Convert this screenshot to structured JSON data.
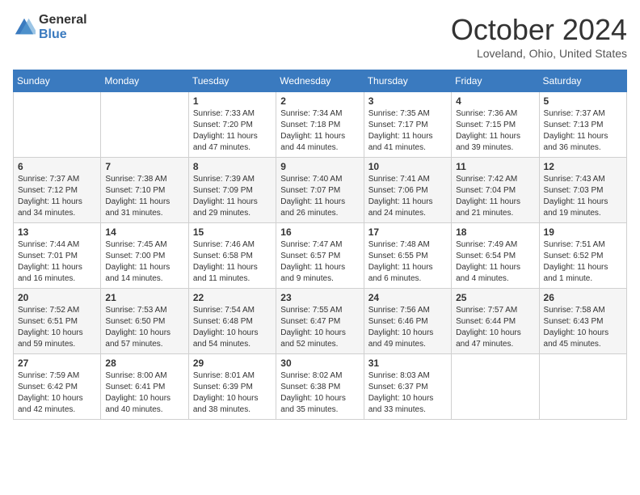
{
  "header": {
    "logo_general": "General",
    "logo_blue": "Blue",
    "month": "October 2024",
    "location": "Loveland, Ohio, United States"
  },
  "days_of_week": [
    "Sunday",
    "Monday",
    "Tuesday",
    "Wednesday",
    "Thursday",
    "Friday",
    "Saturday"
  ],
  "weeks": [
    [
      {
        "day": "",
        "info": ""
      },
      {
        "day": "",
        "info": ""
      },
      {
        "day": "1",
        "info": "Sunrise: 7:33 AM\nSunset: 7:20 PM\nDaylight: 11 hours and 47 minutes."
      },
      {
        "day": "2",
        "info": "Sunrise: 7:34 AM\nSunset: 7:18 PM\nDaylight: 11 hours and 44 minutes."
      },
      {
        "day": "3",
        "info": "Sunrise: 7:35 AM\nSunset: 7:17 PM\nDaylight: 11 hours and 41 minutes."
      },
      {
        "day": "4",
        "info": "Sunrise: 7:36 AM\nSunset: 7:15 PM\nDaylight: 11 hours and 39 minutes."
      },
      {
        "day": "5",
        "info": "Sunrise: 7:37 AM\nSunset: 7:13 PM\nDaylight: 11 hours and 36 minutes."
      }
    ],
    [
      {
        "day": "6",
        "info": "Sunrise: 7:37 AM\nSunset: 7:12 PM\nDaylight: 11 hours and 34 minutes."
      },
      {
        "day": "7",
        "info": "Sunrise: 7:38 AM\nSunset: 7:10 PM\nDaylight: 11 hours and 31 minutes."
      },
      {
        "day": "8",
        "info": "Sunrise: 7:39 AM\nSunset: 7:09 PM\nDaylight: 11 hours and 29 minutes."
      },
      {
        "day": "9",
        "info": "Sunrise: 7:40 AM\nSunset: 7:07 PM\nDaylight: 11 hours and 26 minutes."
      },
      {
        "day": "10",
        "info": "Sunrise: 7:41 AM\nSunset: 7:06 PM\nDaylight: 11 hours and 24 minutes."
      },
      {
        "day": "11",
        "info": "Sunrise: 7:42 AM\nSunset: 7:04 PM\nDaylight: 11 hours and 21 minutes."
      },
      {
        "day": "12",
        "info": "Sunrise: 7:43 AM\nSunset: 7:03 PM\nDaylight: 11 hours and 19 minutes."
      }
    ],
    [
      {
        "day": "13",
        "info": "Sunrise: 7:44 AM\nSunset: 7:01 PM\nDaylight: 11 hours and 16 minutes."
      },
      {
        "day": "14",
        "info": "Sunrise: 7:45 AM\nSunset: 7:00 PM\nDaylight: 11 hours and 14 minutes."
      },
      {
        "day": "15",
        "info": "Sunrise: 7:46 AM\nSunset: 6:58 PM\nDaylight: 11 hours and 11 minutes."
      },
      {
        "day": "16",
        "info": "Sunrise: 7:47 AM\nSunset: 6:57 PM\nDaylight: 11 hours and 9 minutes."
      },
      {
        "day": "17",
        "info": "Sunrise: 7:48 AM\nSunset: 6:55 PM\nDaylight: 11 hours and 6 minutes."
      },
      {
        "day": "18",
        "info": "Sunrise: 7:49 AM\nSunset: 6:54 PM\nDaylight: 11 hours and 4 minutes."
      },
      {
        "day": "19",
        "info": "Sunrise: 7:51 AM\nSunset: 6:52 PM\nDaylight: 11 hours and 1 minute."
      }
    ],
    [
      {
        "day": "20",
        "info": "Sunrise: 7:52 AM\nSunset: 6:51 PM\nDaylight: 10 hours and 59 minutes."
      },
      {
        "day": "21",
        "info": "Sunrise: 7:53 AM\nSunset: 6:50 PM\nDaylight: 10 hours and 57 minutes."
      },
      {
        "day": "22",
        "info": "Sunrise: 7:54 AM\nSunset: 6:48 PM\nDaylight: 10 hours and 54 minutes."
      },
      {
        "day": "23",
        "info": "Sunrise: 7:55 AM\nSunset: 6:47 PM\nDaylight: 10 hours and 52 minutes."
      },
      {
        "day": "24",
        "info": "Sunrise: 7:56 AM\nSunset: 6:46 PM\nDaylight: 10 hours and 49 minutes."
      },
      {
        "day": "25",
        "info": "Sunrise: 7:57 AM\nSunset: 6:44 PM\nDaylight: 10 hours and 47 minutes."
      },
      {
        "day": "26",
        "info": "Sunrise: 7:58 AM\nSunset: 6:43 PM\nDaylight: 10 hours and 45 minutes."
      }
    ],
    [
      {
        "day": "27",
        "info": "Sunrise: 7:59 AM\nSunset: 6:42 PM\nDaylight: 10 hours and 42 minutes."
      },
      {
        "day": "28",
        "info": "Sunrise: 8:00 AM\nSunset: 6:41 PM\nDaylight: 10 hours and 40 minutes."
      },
      {
        "day": "29",
        "info": "Sunrise: 8:01 AM\nSunset: 6:39 PM\nDaylight: 10 hours and 38 minutes."
      },
      {
        "day": "30",
        "info": "Sunrise: 8:02 AM\nSunset: 6:38 PM\nDaylight: 10 hours and 35 minutes."
      },
      {
        "day": "31",
        "info": "Sunrise: 8:03 AM\nSunset: 6:37 PM\nDaylight: 10 hours and 33 minutes."
      },
      {
        "day": "",
        "info": ""
      },
      {
        "day": "",
        "info": ""
      }
    ]
  ]
}
